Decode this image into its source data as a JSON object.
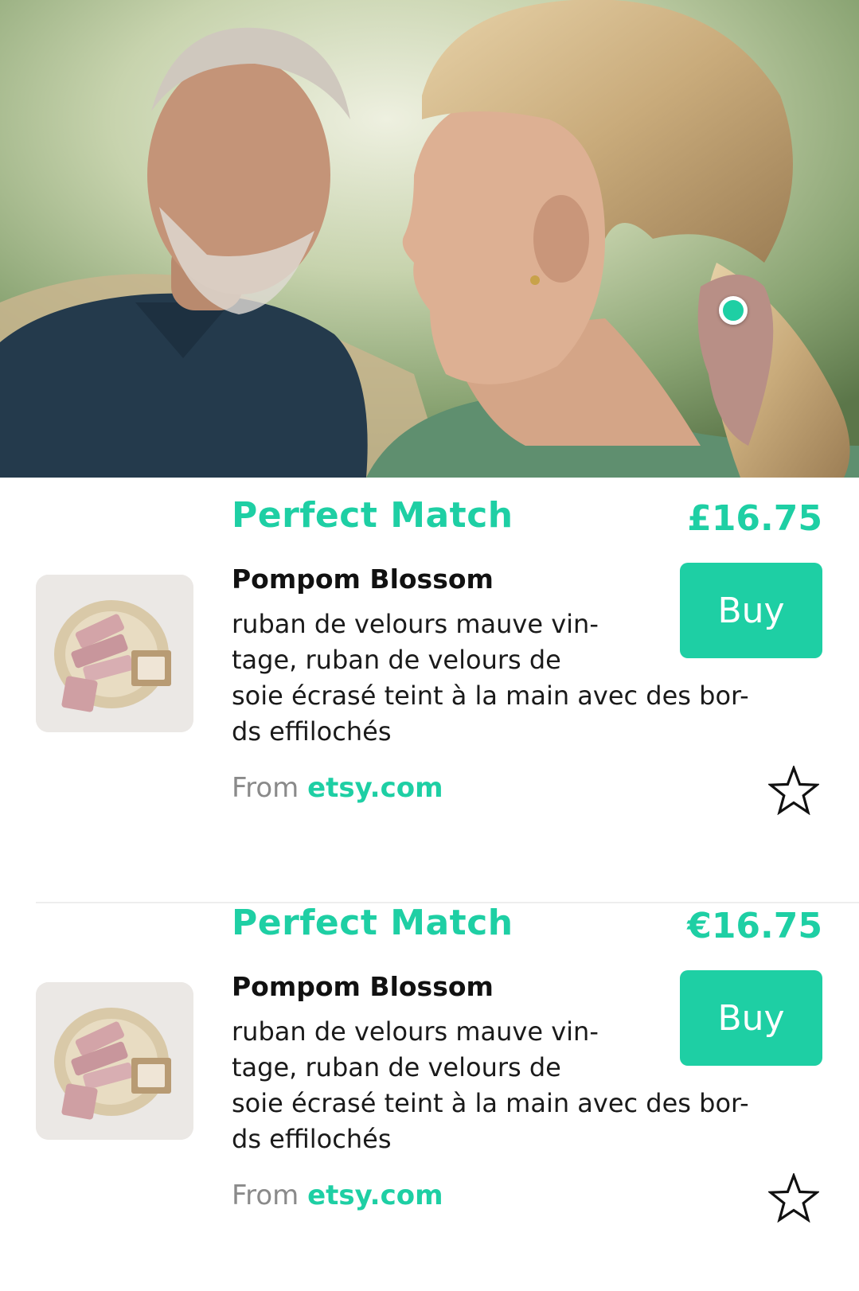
{
  "colors": {
    "accent": "#1ecfa4",
    "muted_text": "#8a8a8a",
    "body_text": "#1a1a1a"
  },
  "hero": {
    "hotspot_icon": "tag-hotspot-dot"
  },
  "products": [
    {
      "match_label": "Perfect Match",
      "price": "£16.75",
      "name": "Pompom Blossom",
      "desc_lines": [
        "ruban de velours mauve vin-",
        "tage, ruban de velours de",
        "soie écrasé teint à la main avec des bor-",
        "ds effilochés"
      ],
      "buy_label": "Buy",
      "from_label": "From",
      "source": "etsy.com",
      "favorite_icon": "star-outline-icon"
    },
    {
      "match_label": "Perfect Match",
      "price": "€16.75",
      "name": "Pompom Blossom",
      "desc_lines": [
        "ruban de velours mauve vin-",
        "tage, ruban de velours de",
        "soie écrasé teint à la main avec des bor-",
        "ds effilochés"
      ],
      "buy_label": "Buy",
      "from_label": "From",
      "source": "etsy.com",
      "favorite_icon": "star-outline-icon"
    }
  ]
}
